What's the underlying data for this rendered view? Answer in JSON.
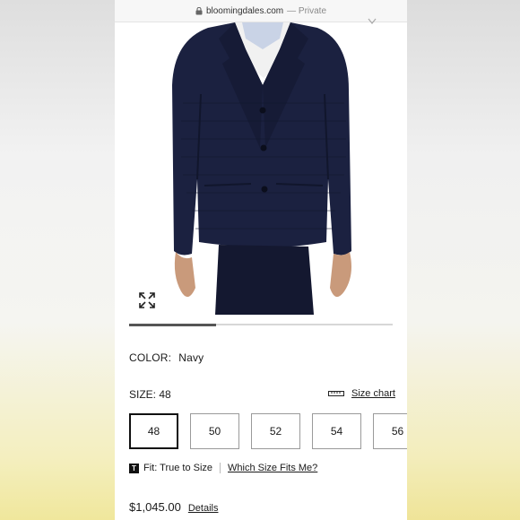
{
  "browser": {
    "domain": "bloomingdales.com",
    "mode": "— Private"
  },
  "image_carousel": {
    "progress_fraction": 0.33
  },
  "product": {
    "color_label": "COLOR:",
    "color_value": "Navy",
    "size_label": "SIZE: 48",
    "size_chart_label": "Size chart",
    "sizes": [
      "48",
      "50",
      "52",
      "54",
      "56"
    ],
    "selected_size": "48",
    "fit_label": "Fit: True to Size",
    "fit_icon_letter": "T",
    "which_size_label": "Which Size Fits Me?",
    "price": "$1,045.00",
    "details_label": "Details"
  },
  "colors": {
    "garment": "#1b2140",
    "garment_dark": "#11162c",
    "skin": "#c99a7b",
    "shirt": "#f3f3f3"
  },
  "icons": {
    "lock": "lock-icon",
    "expand": "expand-icon",
    "ruler": "ruler-icon",
    "chevron": "chevron-down-icon"
  }
}
